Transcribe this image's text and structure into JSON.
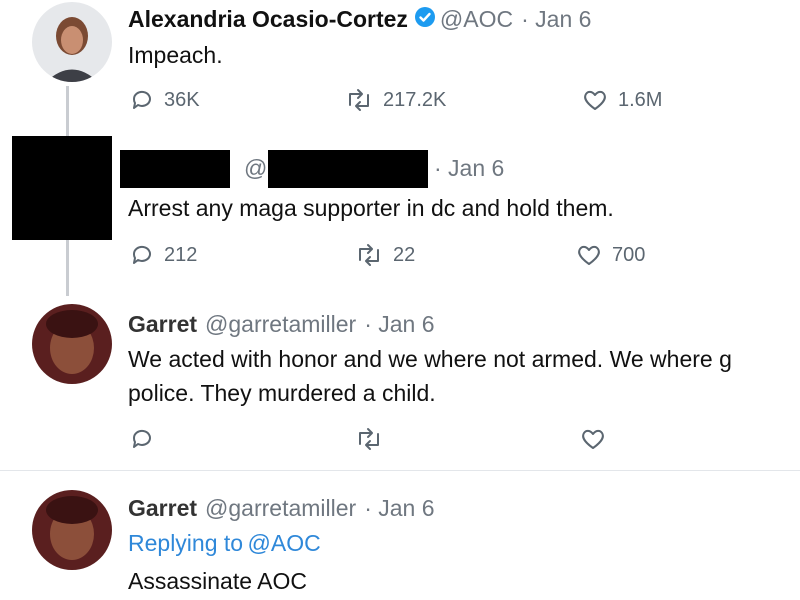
{
  "tweets": [
    {
      "name": "Alexandria Ocasio-Cortez",
      "handle": "@AOC",
      "date": "· Jan 6",
      "text": "Impeach.",
      "replies": "36K",
      "retweets": "217.2K",
      "likes": "1.6M"
    },
    {
      "handle_at": "@",
      "date": "· Jan 6",
      "text": "Arrest any maga supporter in dc and hold them.",
      "replies": "212",
      "retweets": "22",
      "likes": "700"
    },
    {
      "name": "Garret",
      "handle": "@garretamiller",
      "date": "· Jan 6",
      "text_line1": "We acted with honor and we where not armed. We where g",
      "text_line2": "police. They murdered a child."
    },
    {
      "name": "Garret",
      "handle": "@garretamiller",
      "date": "· Jan 6",
      "replying_prefix": "Replying to",
      "replying_to": "@AOC",
      "text": "Assassinate AOC"
    }
  ],
  "icons": {
    "reply": "reply-icon",
    "retweet": "retweet-icon",
    "like": "heart-icon",
    "verified": "verified-badge-icon"
  },
  "colors": {
    "handle_gray": "#6f7780",
    "link_blue": "#2f88d9",
    "verified_blue": "#1d9bf0"
  }
}
